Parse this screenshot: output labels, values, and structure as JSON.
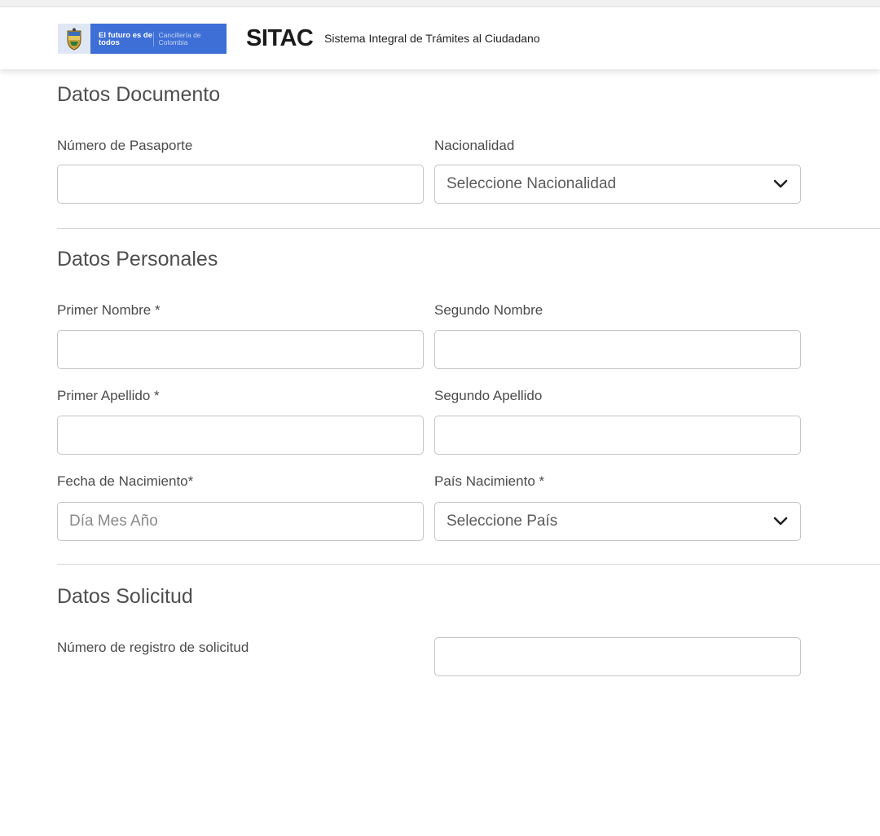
{
  "header": {
    "gov_logo": {
      "slogan": "El futuro es de todos",
      "entity": "Cancillería de Colombia"
    },
    "app_name": "SITAC",
    "app_subtitle": "Sistema Integral de Trámites al Ciudadano"
  },
  "sections": {
    "documento": {
      "title": "Datos Documento",
      "pasaporte_label": "Número de Pasaporte",
      "pasaporte_value": "",
      "nacionalidad_label": "Nacionalidad",
      "nacionalidad_value": "Seleccione Nacionalidad"
    },
    "personales": {
      "title": "Datos Personales",
      "primer_nombre_label": "Primer Nombre *",
      "segundo_nombre_label": "Segundo Nombre",
      "primer_apellido_label": "Primer Apellido *",
      "segundo_apellido_label": "Segundo Apellido",
      "fecha_label": "Fecha de Nacimiento*",
      "fecha_placeholder": "Día Mes Año",
      "pais_label": "País Nacimiento *",
      "pais_value": "Seleccione País"
    },
    "solicitud": {
      "title": "Datos Solicitud",
      "registro_label": "Número de registro de solicitud",
      "registro_value": ""
    }
  },
  "icons": {
    "select_chevron": "chevron-down-icon",
    "gov_shield": "colombia-coat-of-arms-icon"
  },
  "colors": {
    "gov_blue": "#3d6fd6",
    "border": "#c4c4c4",
    "title_text": "#4e4e4e"
  }
}
